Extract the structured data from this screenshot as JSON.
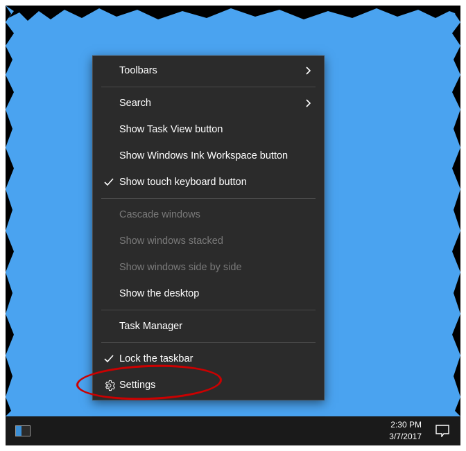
{
  "menu": {
    "toolbars": "Toolbars",
    "search": "Search",
    "show_task_view": "Show Task View button",
    "show_ink": "Show Windows Ink Workspace button",
    "show_touch_kb": "Show touch keyboard button",
    "cascade": "Cascade windows",
    "stacked": "Show windows stacked",
    "side_by_side": "Show windows side by side",
    "show_desktop": "Show the desktop",
    "task_manager": "Task Manager",
    "lock_taskbar": "Lock the taskbar",
    "settings": "Settings"
  },
  "taskbar": {
    "time": "2:30 PM",
    "date": "3/7/2017"
  },
  "colors": {
    "desktop_bg": "#4aa3f0",
    "menu_bg": "#2b2b2b",
    "taskbar_bg": "#1a1a1a",
    "highlight": "#cc0000"
  }
}
